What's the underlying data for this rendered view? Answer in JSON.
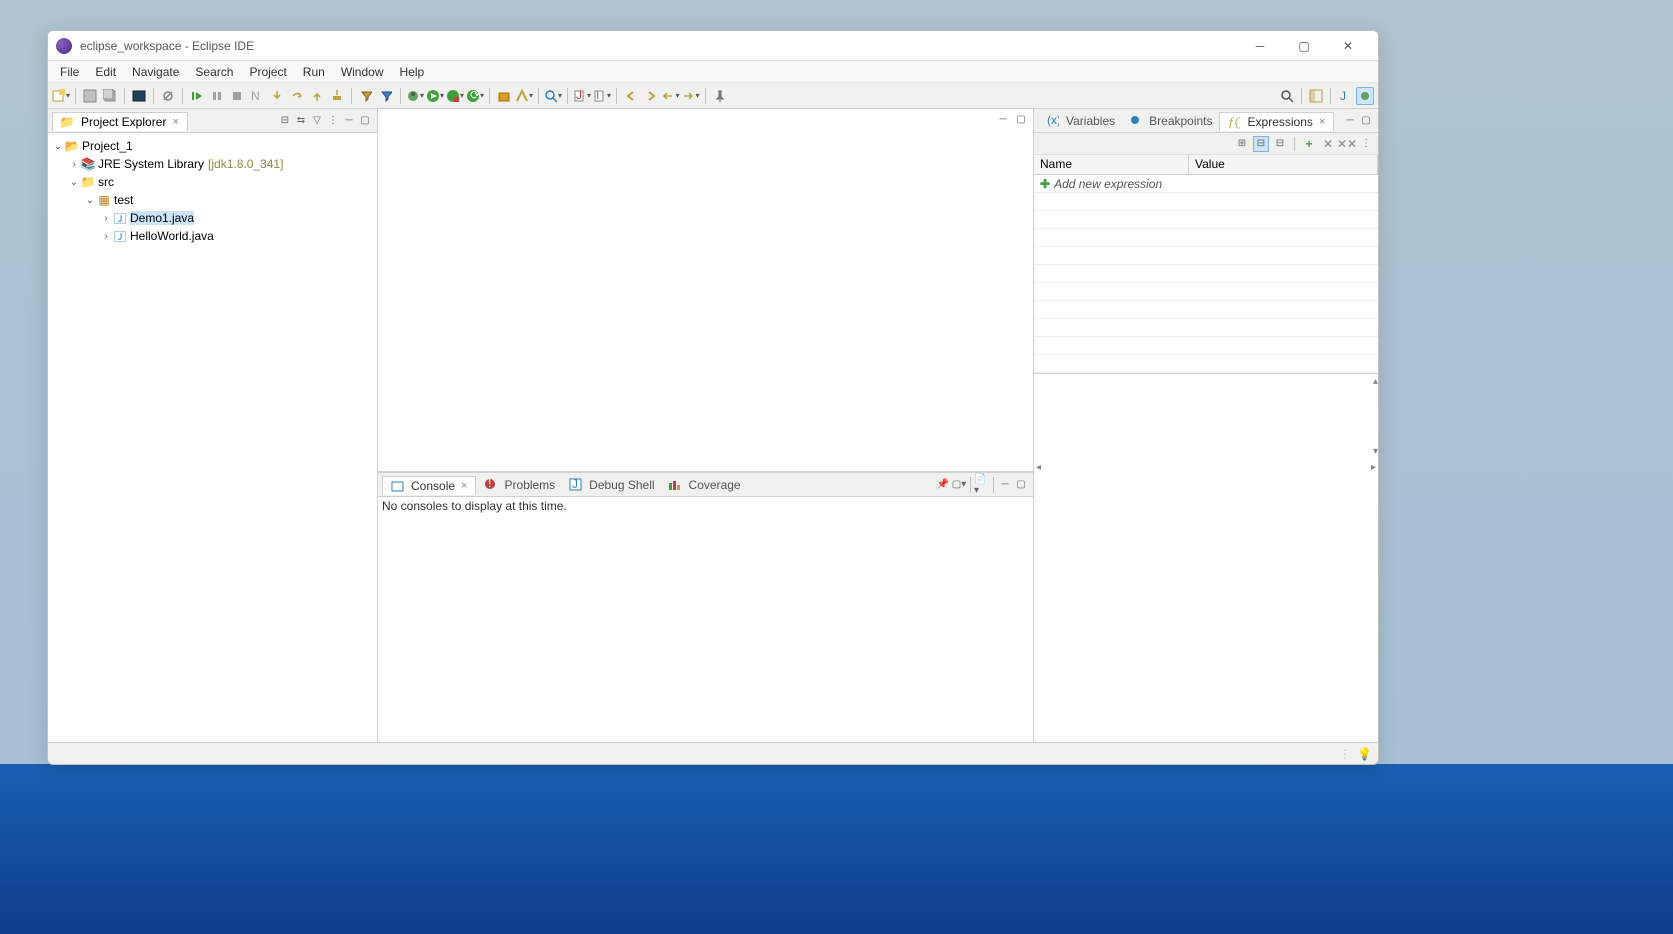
{
  "window": {
    "title": "eclipse_workspace - Eclipse IDE"
  },
  "menus": [
    "File",
    "Edit",
    "Navigate",
    "Search",
    "Project",
    "Run",
    "Window",
    "Help"
  ],
  "project_explorer": {
    "title": "Project Explorer",
    "project": "Project_1",
    "jre": "JRE System Library",
    "jre_version": "[jdk1.8.0_341]",
    "src": "src",
    "pkg": "test",
    "files": [
      "Demo1.java",
      "HelloWorld.java"
    ],
    "selected": 0
  },
  "bottom_tabs": {
    "console": "Console",
    "problems": "Problems",
    "debug_shell": "Debug Shell",
    "coverage": "Coverage"
  },
  "console_msg": "No consoles to display at this time.",
  "right_tabs": {
    "variables": "Variables",
    "breakpoints": "Breakpoints",
    "expressions": "Expressions"
  },
  "expr_table": {
    "name_col": "Name",
    "value_col": "Value",
    "add_label": "Add new expression"
  }
}
